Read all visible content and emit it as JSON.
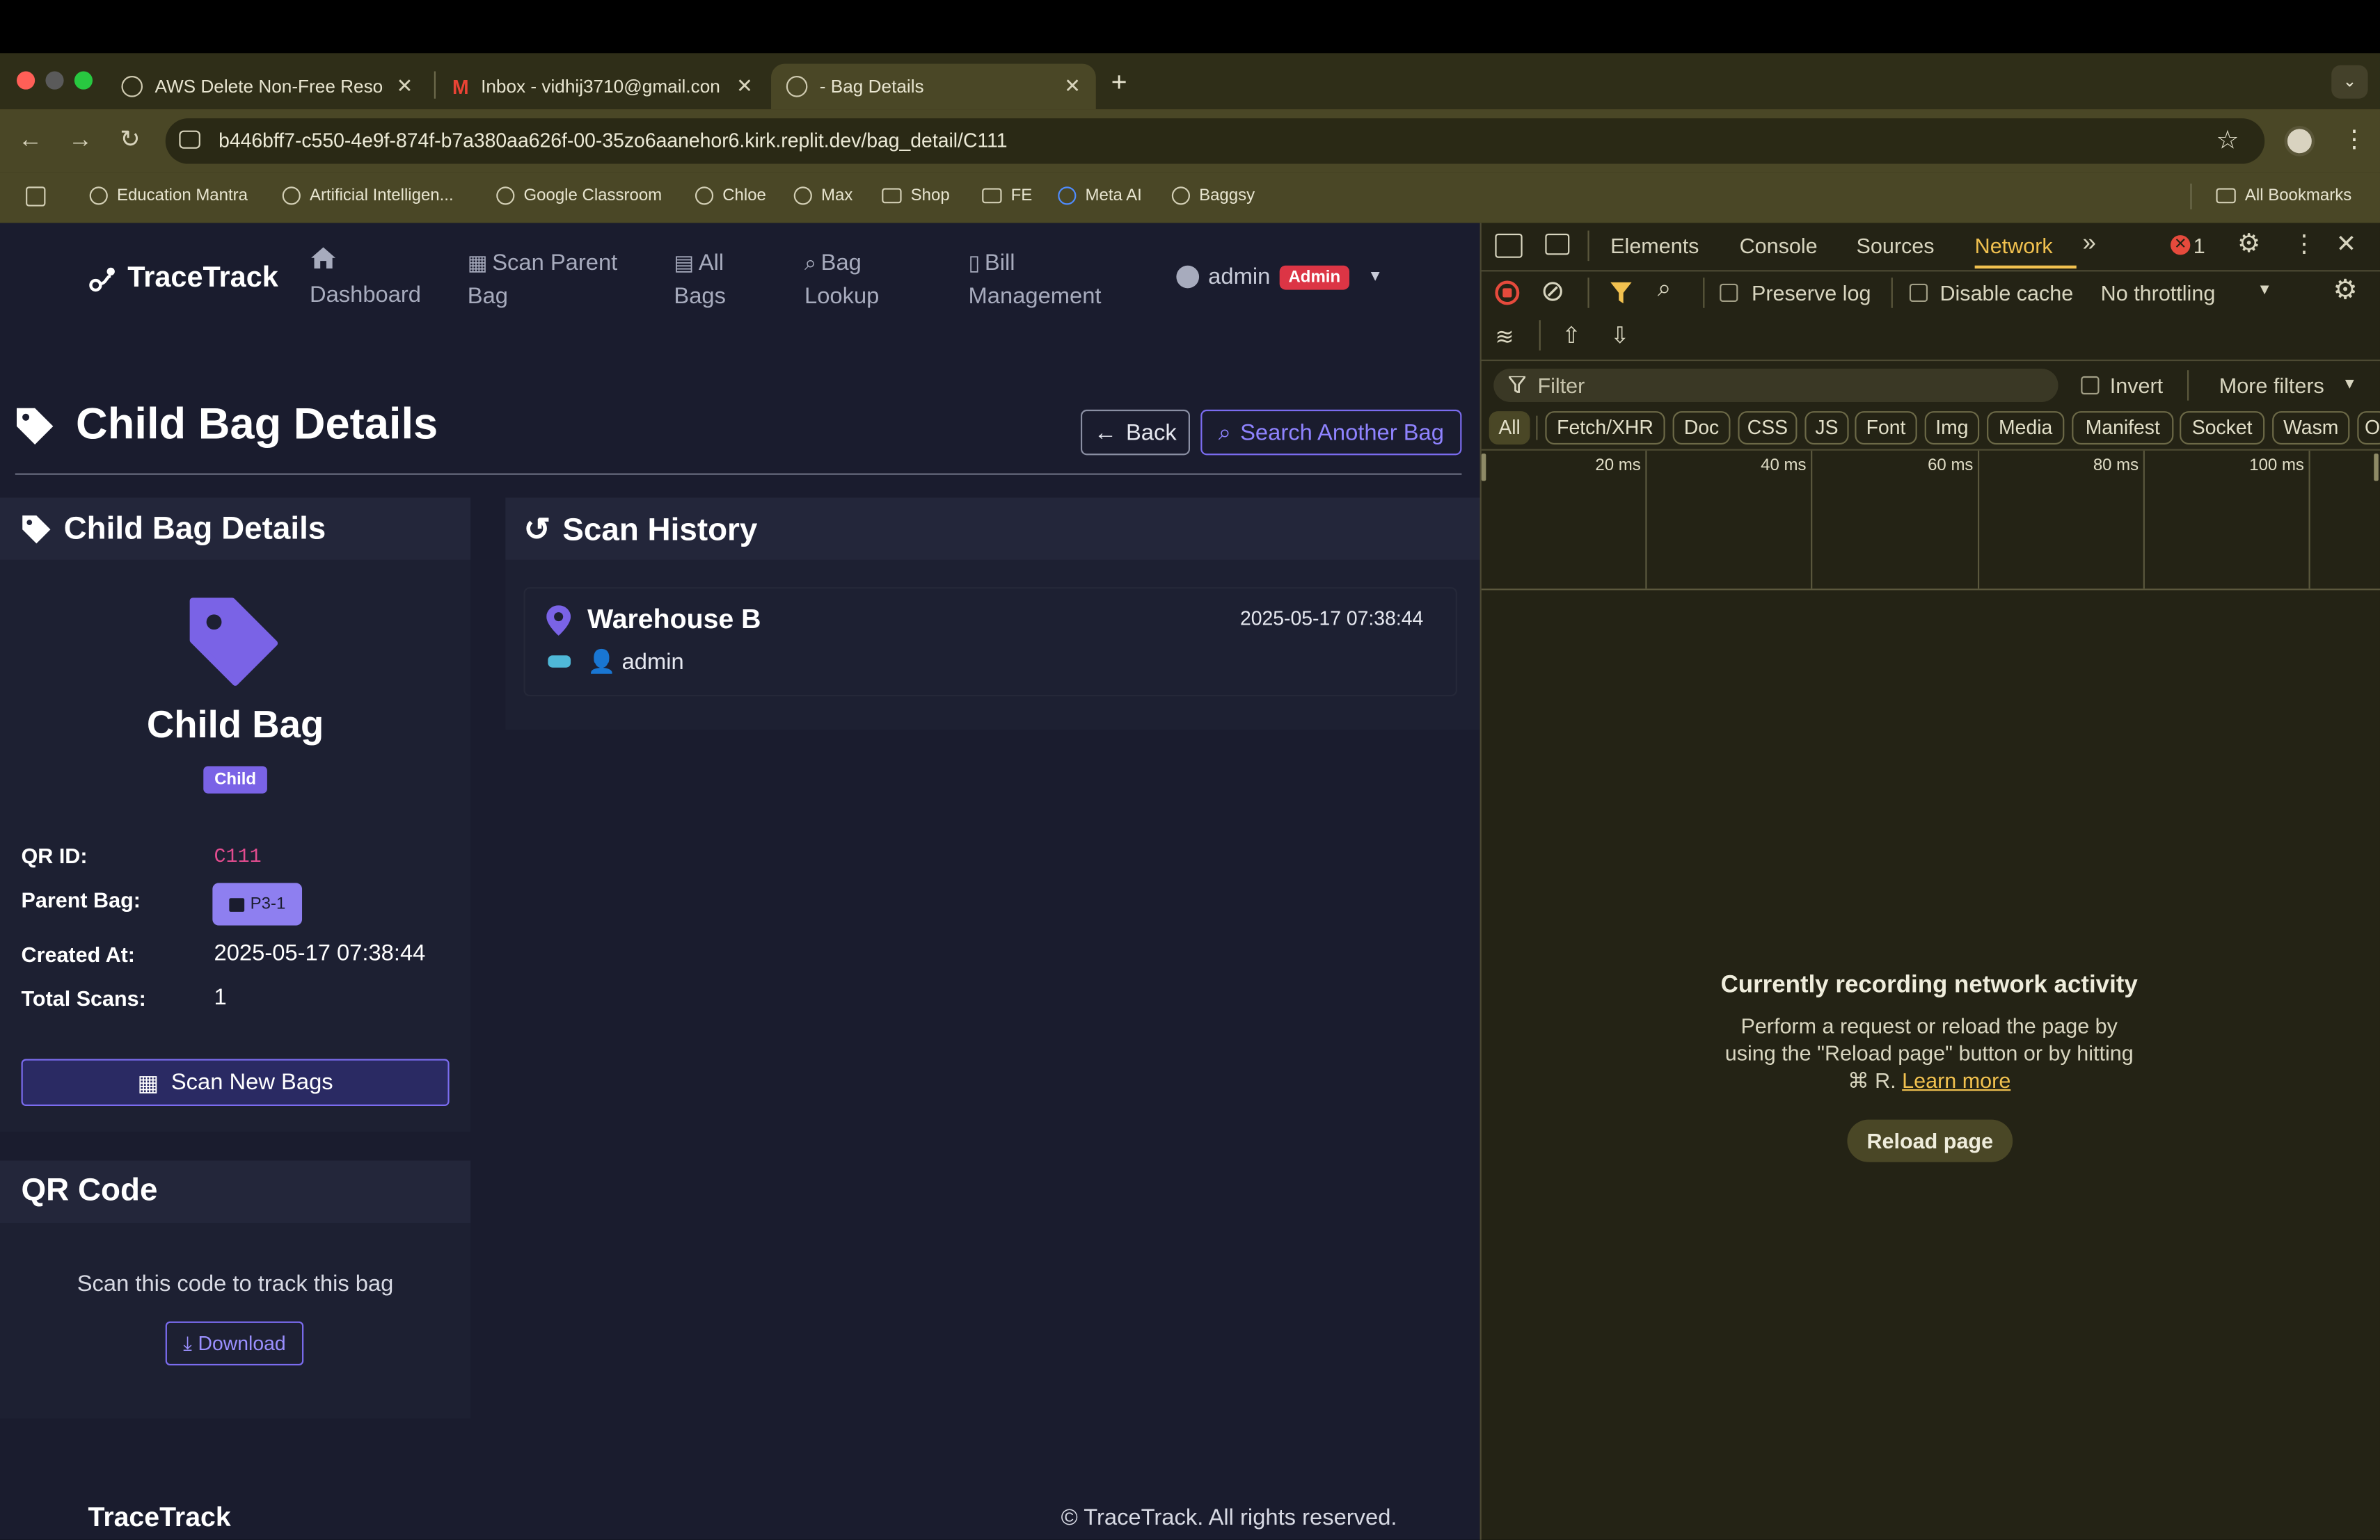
{
  "browser": {
    "tabs": [
      {
        "title": "AWS Delete Non-Free Resour",
        "close": "✕"
      },
      {
        "title": "Inbox - vidhij3710@gmail.con",
        "close": "✕"
      },
      {
        "title": "- Bag Details",
        "close": "✕"
      }
    ],
    "new_tab": "+",
    "url": "b446bff7-c550-4e9f-874f-b7a380aa626f-00-35zo6aanehor6.kirk.replit.dev/bag_detail/C111",
    "bookmarks": [
      "Education Mantra",
      "Artificial Intelligen...",
      "Google Classroom",
      "Chloe",
      "Max",
      "Shop",
      "FE",
      "Meta AI",
      "Baggsy"
    ],
    "all_bookmarks": "All Bookmarks"
  },
  "app": {
    "brand": "TraceTrack",
    "nav": [
      {
        "line1": "Dashboard",
        "line2": ""
      },
      {
        "line1": "Scan Parent",
        "line2": "Bag"
      },
      {
        "line1": "All",
        "line2": "Bags"
      },
      {
        "line1": "Bag",
        "line2": "Lookup"
      },
      {
        "line1": "Bill",
        "line2": "Management"
      }
    ],
    "user": "admin",
    "role_badge": "Admin",
    "page_title": "Child Bag Details",
    "back_label": "Back",
    "search_label": "Search Another Bag",
    "details_card": {
      "title": "Child Bag Details",
      "bag_name": "Child Bag",
      "type_badge": "Child",
      "fields": [
        {
          "label": "QR ID:",
          "value": "C111"
        },
        {
          "label": "Parent Bag:",
          "value": "P3-1"
        },
        {
          "label": "Created At:",
          "value": "2025-05-17 07:38:44"
        },
        {
          "label": "Total Scans:",
          "value": "1"
        }
      ],
      "scan_button": "Scan New Bags"
    },
    "qr_card": {
      "title": "QR Code",
      "caption": "Scan this code to track this bag",
      "download": "Download"
    },
    "history_card": {
      "title": "Scan History",
      "entries": [
        {
          "location": "Warehouse B",
          "user": "admin",
          "time": "2025-05-17 07:38:44"
        }
      ]
    },
    "footer": {
      "brand": "TraceTrack",
      "copyright": "© TraceTrack. All rights reserved."
    }
  },
  "devtools": {
    "tabs": [
      "Elements",
      "Console",
      "Sources",
      "Network"
    ],
    "active_tab": "Network",
    "error_count": "1",
    "preserve_log": "Preserve log",
    "disable_cache": "Disable cache",
    "throttling": "No throttling",
    "filter_placeholder": "Filter",
    "invert": "Invert",
    "more_filters": "More filters",
    "type_filters": [
      "All",
      "Fetch/XHR",
      "Doc",
      "CSS",
      "JS",
      "Font",
      "Img",
      "Media",
      "Manifest",
      "Socket",
      "Wasm",
      "O"
    ],
    "timeline_ticks": [
      "20 ms",
      "40 ms",
      "60 ms",
      "80 ms",
      "100 ms"
    ],
    "empty_title": "Currently recording network activity",
    "empty_line1": "Perform a request or reload the page by",
    "empty_line2": "using the \"Reload page\" button or by hitting",
    "empty_line3": "⌘ R.",
    "learn_more": "Learn more",
    "reload_button": "Reload page"
  },
  "colors": {
    "app_bg": "#1a1c2e",
    "accent": "#7b6cf0",
    "danger": "#dc3545",
    "devtools_bg": "#242315",
    "devtools_accent": "#e6b23c"
  }
}
